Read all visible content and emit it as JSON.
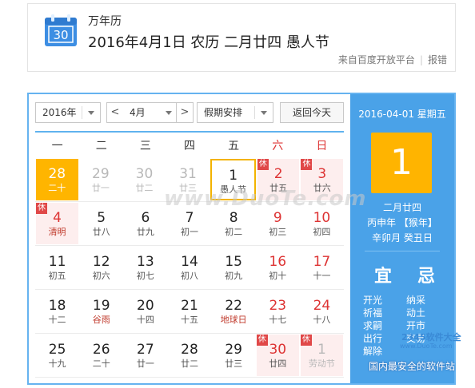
{
  "header": {
    "icon_day": "30",
    "app_name": "万年历",
    "headline": "2016年4月1日 农历 二月廿四 愚人节",
    "source": "来自百度开放平台",
    "report": "报错"
  },
  "toolbar": {
    "year": "2016年",
    "month": "4月",
    "prev": "<",
    "next": ">",
    "holiday": "假期安排",
    "today_btn": "返回今天"
  },
  "weekdays": [
    "一",
    "二",
    "三",
    "四",
    "五",
    "六",
    "日"
  ],
  "rows": [
    [
      {
        "d": "28",
        "l": "二十",
        "state": "selected"
      },
      {
        "d": "29",
        "l": "廿一",
        "state": "other"
      },
      {
        "d": "30",
        "l": "廿二",
        "state": "other"
      },
      {
        "d": "31",
        "l": "廿三",
        "state": "other"
      },
      {
        "d": "1",
        "l": "愚人节",
        "state": "today"
      },
      {
        "d": "2",
        "l": "廿五",
        "state": "holiday",
        "tag": "休"
      },
      {
        "d": "3",
        "l": "廿六",
        "state": "holiday",
        "tag": "休"
      }
    ],
    [
      {
        "d": "4",
        "l": "清明",
        "state": "holiday",
        "tag": "休"
      },
      {
        "d": "5",
        "l": "廿八"
      },
      {
        "d": "6",
        "l": "廿九"
      },
      {
        "d": "7",
        "l": "初一"
      },
      {
        "d": "8",
        "l": "初二"
      },
      {
        "d": "9",
        "l": "初三",
        "red": true
      },
      {
        "d": "10",
        "l": "初四",
        "red": true
      }
    ],
    [
      {
        "d": "11",
        "l": "初五"
      },
      {
        "d": "12",
        "l": "初六"
      },
      {
        "d": "13",
        "l": "初七"
      },
      {
        "d": "14",
        "l": "初八"
      },
      {
        "d": "15",
        "l": "初九"
      },
      {
        "d": "16",
        "l": "初十",
        "red": true
      },
      {
        "d": "17",
        "l": "十一",
        "red": true
      }
    ],
    [
      {
        "d": "18",
        "l": "十二"
      },
      {
        "d": "19",
        "l": "谷雨",
        "festival": true
      },
      {
        "d": "20",
        "l": "十四"
      },
      {
        "d": "21",
        "l": "十五"
      },
      {
        "d": "22",
        "l": "地球日",
        "festival": true
      },
      {
        "d": "23",
        "l": "十七",
        "red": true
      },
      {
        "d": "24",
        "l": "十八",
        "red": true
      }
    ],
    [
      {
        "d": "25",
        "l": "十九"
      },
      {
        "d": "26",
        "l": "二十"
      },
      {
        "d": "27",
        "l": "廿一"
      },
      {
        "d": "28",
        "l": "廿二"
      },
      {
        "d": "29",
        "l": "廿三"
      },
      {
        "d": "30",
        "l": "廿四",
        "state": "holiday",
        "tag": "休"
      },
      {
        "d": "1",
        "l": "劳动节",
        "state": "holiday-other",
        "tag": "休"
      }
    ]
  ],
  "side": {
    "date": "2016-04-01 星期五",
    "day": "1",
    "lunar_day": "二月廿四",
    "ganzhi_year": "丙申年 【猴年】",
    "ganzhi_month_day": "辛卯月 癸丑日",
    "yi": "宜",
    "ji": "忌",
    "yi_items": [
      "开光",
      "祈福",
      "求嗣",
      "出行",
      "解除"
    ],
    "ji_items": [
      "纳采",
      "动土",
      "开市",
      "交易"
    ]
  },
  "watermarks": {
    "center": "www.DuoTe.com",
    "corner_title": "2345软件大全",
    "corner_url": "www.DuoTe.com",
    "footer": "国内最安全的软件站"
  },
  "colors": {
    "accent_blue": "#4aa2e8",
    "selected_orange": "#ffb500",
    "holiday_red": "#e04848"
  }
}
